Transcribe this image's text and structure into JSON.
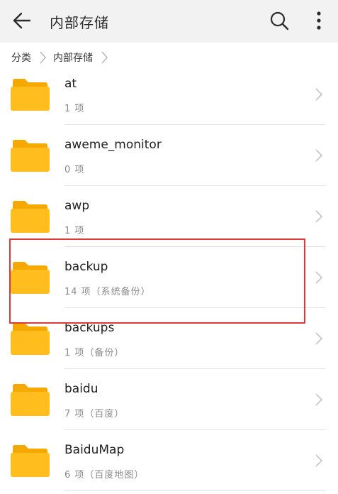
{
  "header": {
    "title": "内部存储",
    "back_icon": "arrow-left-icon",
    "search_icon": "search-icon",
    "more_icon": "more-vertical-icon"
  },
  "breadcrumb": {
    "items": [
      "分类",
      "内部存储"
    ]
  },
  "folders": [
    {
      "name": "at",
      "meta": "1 项"
    },
    {
      "name": "aweme_monitor",
      "meta": "0 项"
    },
    {
      "name": "awp",
      "meta": "1 项"
    },
    {
      "name": "backup",
      "meta": "14 项（系统备份）"
    },
    {
      "name": "backups",
      "meta": "1 项（备份）"
    },
    {
      "name": "baidu",
      "meta": "7 项（百度）"
    },
    {
      "name": "BaiduMap",
      "meta": "6 项（百度地图）"
    }
  ],
  "colors": {
    "folder": "#FFBE1E",
    "folder_dark": "#F5A800",
    "highlight": "#E0393A"
  }
}
